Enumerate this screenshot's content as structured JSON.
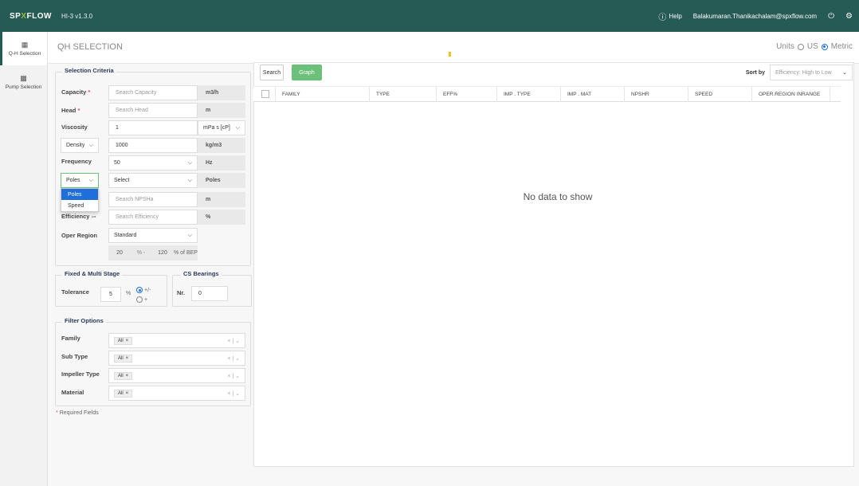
{
  "app": {
    "brand_a": "SP",
    "brand_b": "X",
    "brand_c": "FLOW",
    "version": "HI-3 v1.3.0",
    "help_label": "Help",
    "user_email": "Balakumaran.Thanikachalam@spxflow.com"
  },
  "sidebar": {
    "items": [
      {
        "label": "Q-H Selection",
        "icon": "grid-icon"
      },
      {
        "label": "Pump Selection",
        "icon": "database-icon"
      }
    ]
  },
  "page": {
    "title": "QH SELECTION",
    "units_label": "Units",
    "unit_us": "US",
    "unit_metric": "Metric",
    "selected_unit": "Metric"
  },
  "criteria": {
    "legend": "Selection Criteria",
    "capacity_label": "Capacity",
    "capacity_placeholder": "Search Capacity",
    "capacity_unit": "m3/h",
    "head_label": "Head",
    "head_placeholder": "Search Head",
    "head_unit": "m",
    "viscosity_label": "Viscosity",
    "viscosity_value": "1",
    "viscosity_unit": "mPa s [cP]",
    "density_select": "Density",
    "density_value": "1000",
    "density_unit": "kg/m3",
    "frequency_label": "Frequency",
    "frequency_value": "50",
    "frequency_unit": "Hz",
    "poles_select": "Poles",
    "poles_value": "Select",
    "poles_unit": "Poles",
    "npsha_placeholder": "Search NPSHa",
    "npsha_unit": "m",
    "efficiency_label": "Efficiency",
    "efficiency_op": ">=",
    "efficiency_placeholder": "Search Efficiency",
    "efficiency_unit": "%",
    "oper_region_label": "Oper Region",
    "oper_region_value": "Standard",
    "bep_min": "20",
    "bep_sep": "% -",
    "bep_max": "120",
    "bep_unit": "% of BEP",
    "dropdown_options": [
      "Poles",
      "Speed"
    ]
  },
  "fixed_multi": {
    "legend": "Fixed & Multi Stage",
    "tolerance_label": "Tolerance",
    "tolerance_value": "5",
    "tolerance_unit": "%",
    "opt_plus_minus": "+/-",
    "opt_plus": "+"
  },
  "cs_bearings": {
    "legend": "CS Bearings",
    "nr_label": "Nr.",
    "nr_value": "0"
  },
  "filters": {
    "legend": "Filter Options",
    "rows": [
      {
        "label": "Family",
        "tag": "All"
      },
      {
        "label": "Sub Type",
        "tag": "All"
      },
      {
        "label": "Impeller Type",
        "tag": "All"
      },
      {
        "label": "Material",
        "tag": "All"
      }
    ],
    "required_note": "Required Fields"
  },
  "results": {
    "search_label": "Search",
    "graph_label": "Graph",
    "sort_by_label": "Sort by",
    "sort_value": "Efficiency: High to Low",
    "columns": [
      "FAMILY",
      "TYPE",
      "EFF%",
      "IMP . TYPE",
      "IMP . MAT",
      "NPSHR",
      "SPEED",
      "OPER.REGION INRANGE"
    ],
    "empty_message": "No data to show"
  }
}
